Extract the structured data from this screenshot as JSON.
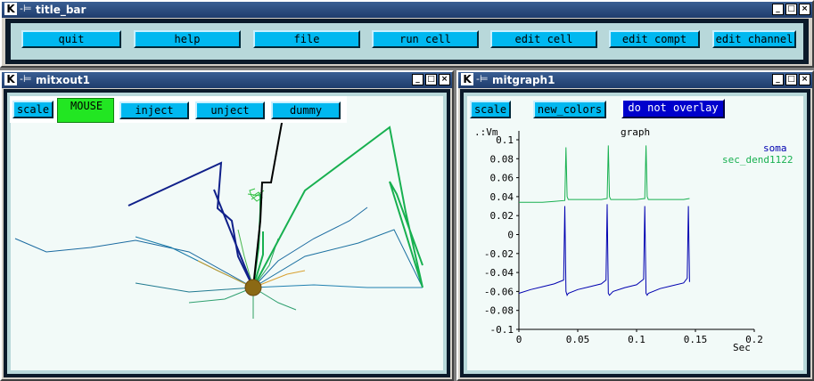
{
  "colors": {
    "button": "#00b8f0",
    "mouse_bg": "#22e622",
    "overlay_btn": "#0000cc",
    "soma": "#0000b0",
    "dend": "#18b050",
    "canvas": "#f2faf8"
  },
  "title_bar_window": {
    "title": "title_bar",
    "buttons": [
      {
        "label": "quit"
      },
      {
        "label": "help"
      },
      {
        "label": "file"
      },
      {
        "label": "run cell"
      },
      {
        "label": "edit cell"
      },
      {
        "label": "edit compt"
      },
      {
        "label": "edit channel"
      }
    ]
  },
  "draw_window": {
    "title": "mitxout1",
    "scale_label": "scale",
    "mouse_label": "MOUSE",
    "buttons": [
      {
        "label": "inject"
      },
      {
        "label": "unject"
      },
      {
        "label": "dummy"
      }
    ]
  },
  "graph_window": {
    "title": "mitgraph1",
    "scale_label": "scale",
    "new_colors_label": "new_colors",
    "overlay_label": "do not overlay"
  },
  "window_controls": {
    "minimize": "_",
    "maximize": "□",
    "close": "×",
    "pin": "-⊨"
  },
  "chart_data": {
    "type": "line",
    "title": "graph",
    "ylabel": ".:Vm",
    "xlabel": "Sec",
    "xlim": [
      0,
      0.2
    ],
    "ylim": [
      -0.1,
      0.1
    ],
    "x_ticks": [
      "0",
      "0.05",
      "0.1",
      "0.15",
      "0.2"
    ],
    "y_ticks": [
      "0.1",
      "0.08",
      "0.06",
      "0.04",
      "0.02",
      "0",
      "-0.02",
      "-0.04",
      "-0.06",
      "-0.08",
      "-0.1"
    ],
    "series": [
      {
        "name": "soma",
        "color": "#0000b0",
        "x": [
          0,
          0.01,
          0.02,
          0.03,
          0.038,
          0.039,
          0.04,
          0.041,
          0.042,
          0.05,
          0.06,
          0.07,
          0.074,
          0.075,
          0.076,
          0.077,
          0.08,
          0.09,
          0.1,
          0.106,
          0.107,
          0.108,
          0.109,
          0.11,
          0.12,
          0.13,
          0.14,
          0.143,
          0.144,
          0.145
        ],
        "y": [
          -0.062,
          -0.058,
          -0.055,
          -0.052,
          -0.048,
          0.03,
          -0.06,
          -0.064,
          -0.062,
          -0.058,
          -0.055,
          -0.052,
          -0.048,
          0.032,
          -0.062,
          -0.064,
          -0.06,
          -0.056,
          -0.053,
          -0.047,
          0.03,
          -0.062,
          -0.064,
          -0.062,
          -0.057,
          -0.054,
          -0.051,
          -0.046,
          0.03,
          -0.05
        ]
      },
      {
        "name": "sec_dend1122",
        "color": "#18b050",
        "x": [
          0,
          0.01,
          0.02,
          0.03,
          0.039,
          0.04,
          0.041,
          0.042,
          0.05,
          0.06,
          0.07,
          0.075,
          0.076,
          0.077,
          0.078,
          0.09,
          0.1,
          0.107,
          0.108,
          0.109,
          0.11,
          0.12,
          0.13,
          0.14,
          0.145
        ],
        "y": [
          0.034,
          0.034,
          0.034,
          0.035,
          0.036,
          0.092,
          0.04,
          0.037,
          0.037,
          0.037,
          0.037,
          0.038,
          0.094,
          0.04,
          0.037,
          0.037,
          0.037,
          0.038,
          0.094,
          0.04,
          0.037,
          0.037,
          0.037,
          0.037,
          0.038
        ]
      }
    ]
  }
}
